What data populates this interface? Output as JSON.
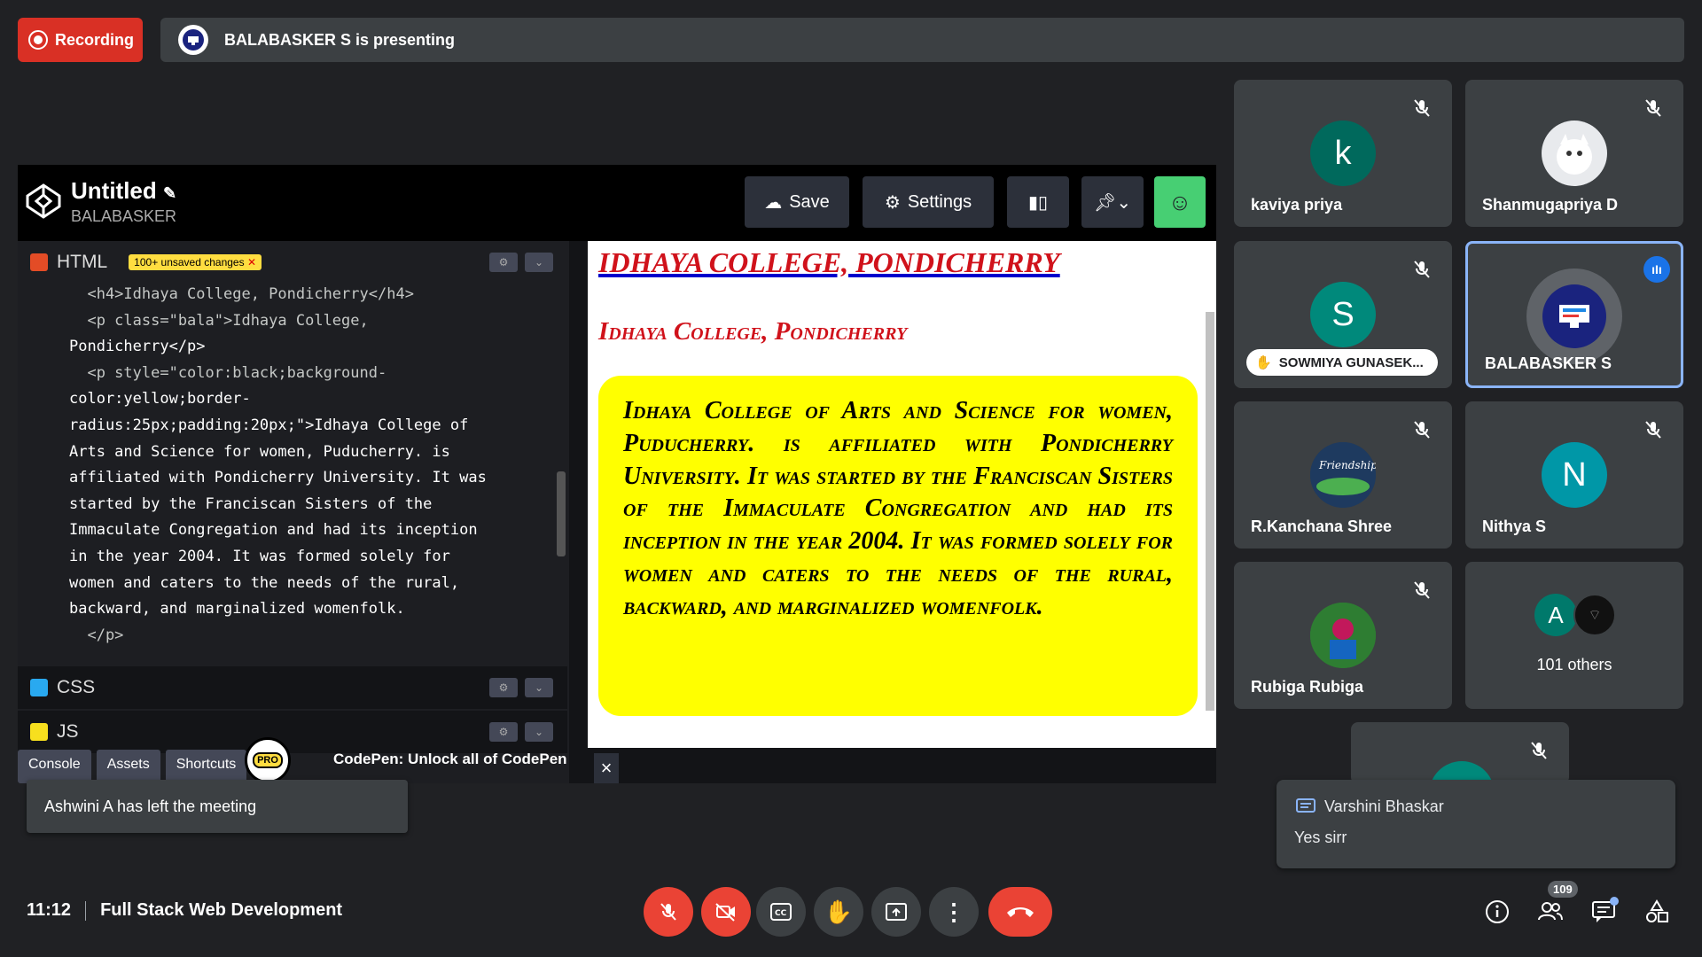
{
  "top": {
    "recording_label": "Recording",
    "presenting_text": "BALABASKER S is presenting"
  },
  "codepen": {
    "title": "Untitled",
    "user": "BALABASKER",
    "save_label": "Save",
    "settings_label": "Settings",
    "html_tab": "HTML",
    "unsaved_badge": "100+ unsaved changes",
    "css_tab": "CSS",
    "js_tab": "JS",
    "bottom_tabs": [
      "Console",
      "Assets",
      "Shortcuts"
    ],
    "pro_badge": "PRO",
    "promo_text": "CodePen: Unlock all of CodePen",
    "code_lines": [
      "  <h4>Idhaya College, Pondicherry</h4>",
      "  <p class=\"bala\">Idhaya College,",
      "Pondicherry</p>",
      "  <p style=\"color:black;background-",
      "color:yellow;border-",
      "radius:25px;padding:20px;\">Idhaya College of",
      "Arts and Science for women, Puducherry. is",
      "affiliated with Pondicherry University. It was",
      "started by the Franciscan Sisters of the",
      "Immaculate Congregation and had its inception",
      "in the year 2004. It was formed solely for",
      "women and caters to the needs of the rural,",
      "backward, and marginalized womenfolk.",
      "  </p>"
    ]
  },
  "preview": {
    "h4": "IDHAYA COLLEGE, PONDICHERRY",
    "bala": "Idhaya College, Pondicherry",
    "box_text": "Idhaya College of Arts and Science for women, Puducherry. is affiliated with Pondicherry University. It was started by the Franciscan Sisters of the Immaculate Congregation and had its inception in the year 2004. It was formed solely for women and caters to the needs of the rural, backward, and marginalized womenfolk."
  },
  "participants": [
    {
      "name": "kaviya priya",
      "initial": "k",
      "color": "#00695c"
    },
    {
      "name": "Shanmugapriya D",
      "initial": "",
      "color": "#e8eaed"
    },
    {
      "name": "SOWMIYA GUNASEK...",
      "initial": "S",
      "color": "#00897b"
    },
    {
      "name": "BALABASKER S",
      "initial": "",
      "color": "#1a237e"
    },
    {
      "name": "R.Kanchana Shree",
      "initial": "",
      "color": "#1e3a5f"
    },
    {
      "name": "Nithya S",
      "initial": "N",
      "color": "#0097a7"
    },
    {
      "name": "Rubiga Rubiga",
      "initial": "",
      "color": "#2e7d32"
    },
    {
      "name": "101 others",
      "initial": "A",
      "color": "#00796b"
    }
  ],
  "toast_left": "Ashwini A has left the meeting",
  "chat": {
    "sender": "Varshini Bhaskar",
    "message": "Yes sirr"
  },
  "bottom": {
    "time": "11:12",
    "meeting_name": "Full Stack Web Development",
    "people_count": "109"
  },
  "colors": {
    "recording": "#d93025",
    "end_call": "#ea4335",
    "active_speaker": "#8ab4f8",
    "highlight_yellow": "#ffff00"
  }
}
